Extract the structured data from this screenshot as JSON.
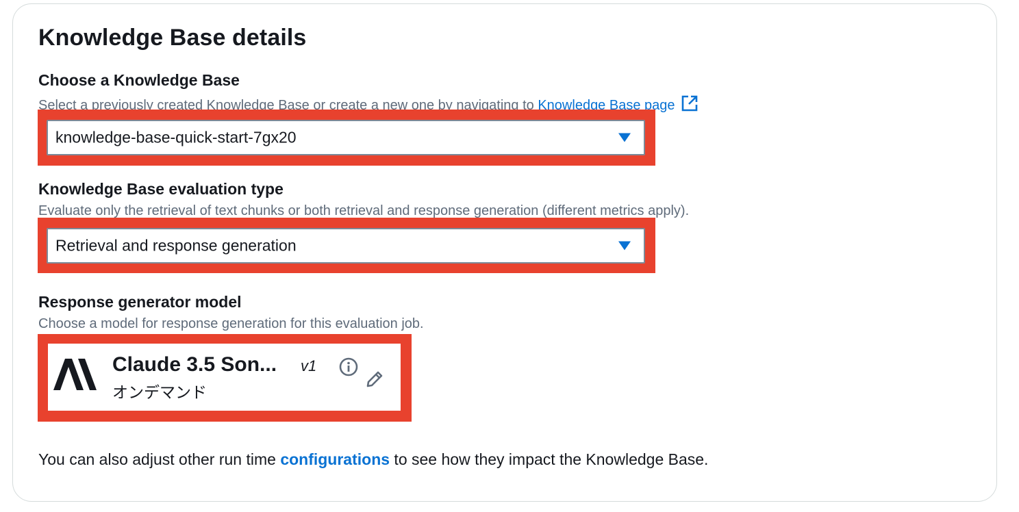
{
  "section": {
    "title": "Knowledge Base details"
  },
  "knowledge_base": {
    "label": "Choose a Knowledge Base",
    "description_prefix": "Select a previously created Knowledge Base or create a new one by navigating to ",
    "description_link": "Knowledge Base page",
    "selected_value": "knowledge-base-quick-start-7gx20"
  },
  "evaluation_type": {
    "label": "Knowledge Base evaluation type",
    "description": "Evaluate only the retrieval of text chunks or both retrieval and response generation (different metrics apply).",
    "selected_value": "Retrieval and response generation"
  },
  "response_model": {
    "label": "Response generator model",
    "description": "Choose a model for response generation for this evaluation job.",
    "model_name": "Claude 3.5 Son...",
    "model_version": "v1",
    "model_subtitle": "オンデマンド",
    "logo_icon": "anthropic-logo",
    "info_icon": "info-icon",
    "edit_icon": "pencil-icon"
  },
  "footer": {
    "text_prefix": "You can also adjust other run time ",
    "link_text": "configurations",
    "text_suffix": " to see how they impact the Knowledge Base."
  },
  "colors": {
    "link": "#0972d3",
    "highlight": "#e8422e",
    "text": "#16191f",
    "muted": "#5f6b7a"
  }
}
